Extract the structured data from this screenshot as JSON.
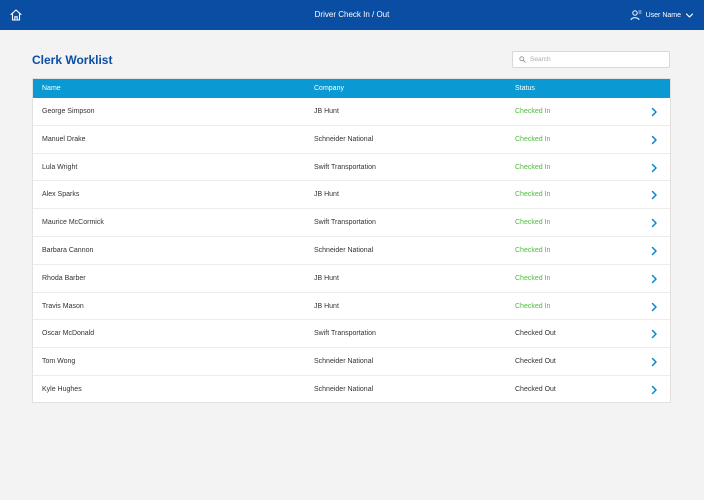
{
  "header": {
    "title": "Driver Check In / Out",
    "user_name": "User Name"
  },
  "page": {
    "title": "Clerk Worklist"
  },
  "search": {
    "placeholder": "Search",
    "value": ""
  },
  "table": {
    "columns": [
      "Name",
      "Company",
      "Status"
    ],
    "rows": [
      {
        "name": "George Simpson",
        "company": "JB Hunt",
        "status": "Checked In"
      },
      {
        "name": "Manuel Drake",
        "company": "Schneider National",
        "status": "Checked In"
      },
      {
        "name": "Lula Wright",
        "company": "Swift Transportation",
        "status": "Checked In"
      },
      {
        "name": "Alex Sparks",
        "company": "JB Hunt",
        "status": "Checked In"
      },
      {
        "name": "Maurice McCormick",
        "company": "Swift Transportation",
        "status": "Checked In"
      },
      {
        "name": "Barbara Cannon",
        "company": "Schneider National",
        "status": "Checked In"
      },
      {
        "name": "Rhoda Barber",
        "company": "JB Hunt",
        "status": "Checked In"
      },
      {
        "name": "Travis Mason",
        "company": "JB Hunt",
        "status": "Checked In"
      },
      {
        "name": "Oscar McDonald",
        "company": "Swift Transportation",
        "status": "Checked Out"
      },
      {
        "name": "Tom Wong",
        "company": "Schneider National",
        "status": "Checked Out"
      },
      {
        "name": "Kyle Hughes",
        "company": "Schneider National",
        "status": "Checked Out"
      }
    ]
  },
  "icons": {
    "home": "home-icon",
    "user": "user-icon",
    "user_menu": "chevron-down-icon",
    "search": "search-icon",
    "row_action": "chevron-right-icon"
  },
  "colors": {
    "header_bg": "#0a4ea3",
    "table_header_bg": "#0a99d2",
    "title": "#0a4ea3",
    "checked_in": "#4cbb3a",
    "checked_out": "#333333",
    "chevron": "#0a86cc",
    "page_bg": "#f3f3f3"
  }
}
